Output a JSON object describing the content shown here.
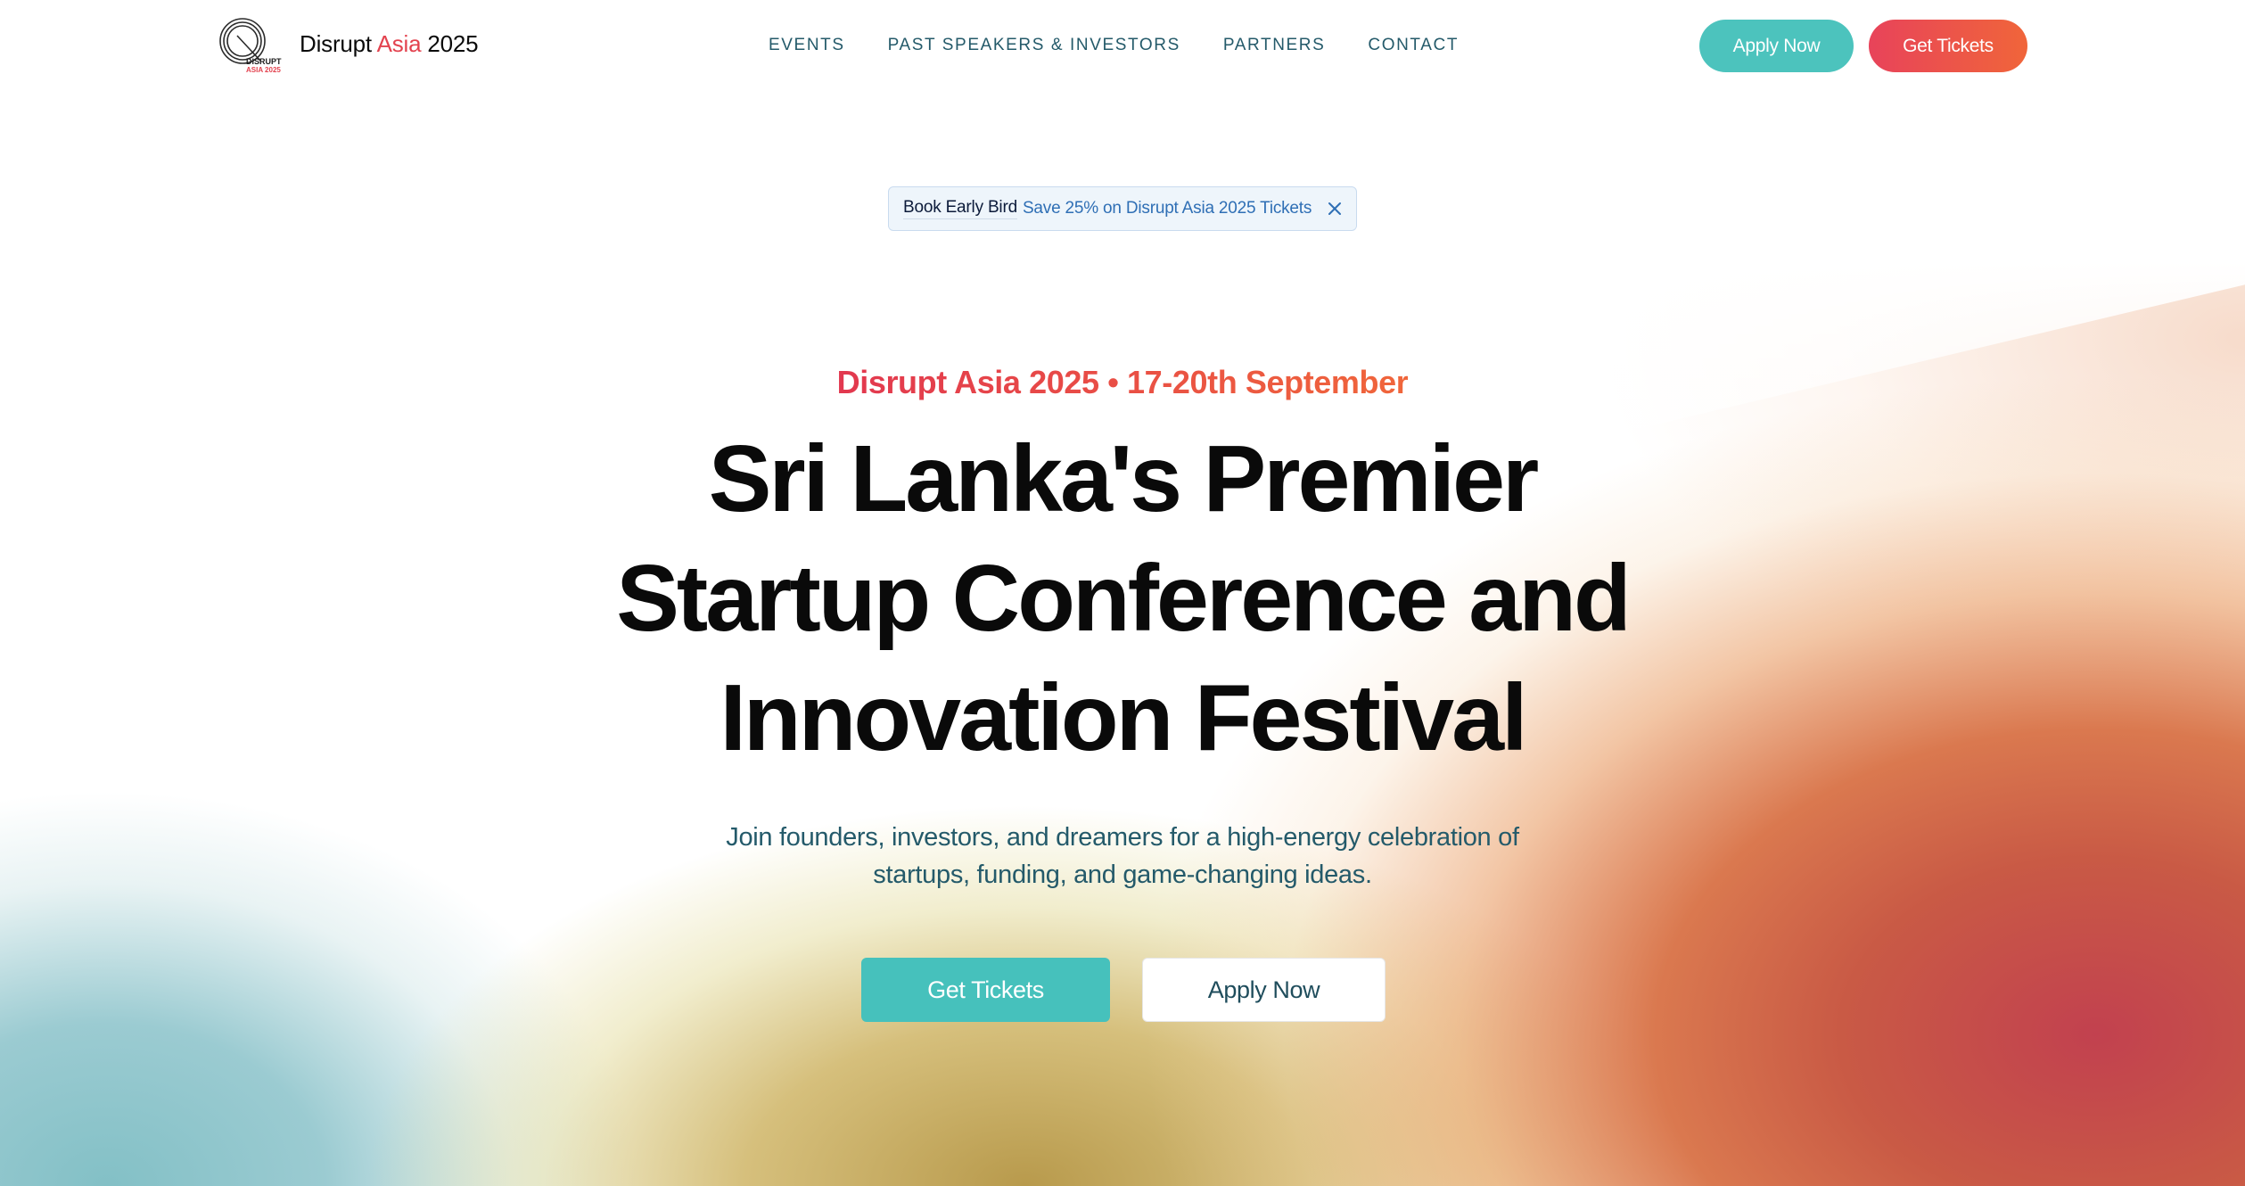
{
  "header": {
    "logo_text_line1": "DISRUPT",
    "logo_text_line2": "ASIA 2025",
    "brand_part1": "Disrupt",
    "brand_part2": "Asia",
    "brand_part3": "2025",
    "nav": [
      {
        "label": "EVENTS"
      },
      {
        "label": "PAST SPEAKERS & INVESTORS"
      },
      {
        "label": "PARTNERS"
      },
      {
        "label": "CONTACT"
      }
    ],
    "apply_label": "Apply Now",
    "tickets_label": "Get Tickets"
  },
  "announcement": {
    "tag": "Book Early Bird",
    "message": "Save 25% on Disrupt Asia 2025 Tickets",
    "close_icon": "close-icon"
  },
  "hero": {
    "eyebrow": "Disrupt Asia 2025 • 17-20th September",
    "headline_line1": "Sri Lanka's Premier",
    "headline_line2": "Startup Conference and",
    "headline_line3": "Innovation Festival",
    "subtext_line1": "Join founders, investors, and dreamers for a high-energy celebration of",
    "subtext_line2": "startups, funding, and game-changing ideas.",
    "tickets_label": "Get Tickets",
    "apply_label": "Apply Now"
  },
  "colors": {
    "accent_teal": "#4cc3bd",
    "accent_red": "#e3434f",
    "accent_orange": "#f0653a",
    "nav_text": "#245a6a",
    "announce_link": "#2f6fb5"
  }
}
